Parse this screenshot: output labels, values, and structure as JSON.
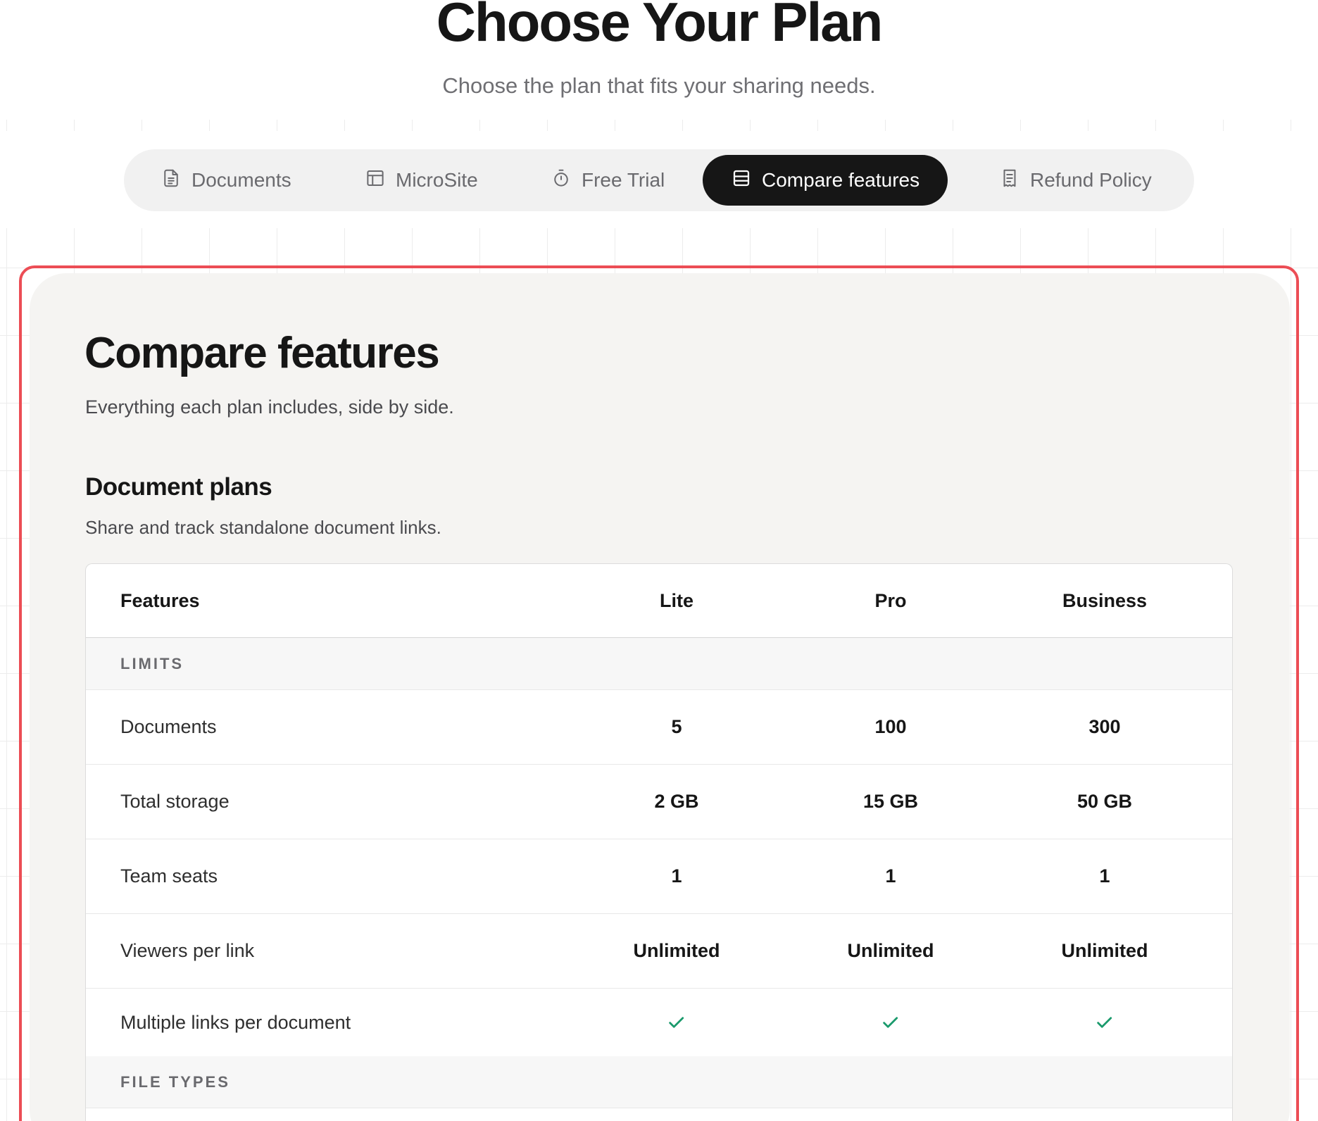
{
  "hero": {
    "title": "Choose Your Plan",
    "subtitle": "Choose the plan that fits your sharing needs."
  },
  "tabs": [
    {
      "label": "Documents",
      "icon": "document-icon",
      "active": false
    },
    {
      "label": "MicroSite",
      "icon": "layout-icon",
      "active": false
    },
    {
      "label": "Free Trial",
      "icon": "stopwatch-icon",
      "active": false
    },
    {
      "label": "Compare features",
      "icon": "table-icon",
      "active": true
    },
    {
      "label": "Refund Policy",
      "icon": "receipt-icon",
      "active": false
    }
  ],
  "compare": {
    "title": "Compare features",
    "subtitle": "Everything each plan includes, side by side.",
    "section": {
      "title": "Document plans",
      "subtitle": "Share and track standalone document links."
    },
    "table": {
      "headers": [
        "Features",
        "Lite",
        "Pro",
        "Business"
      ],
      "groups": [
        {
          "label": "LIMITS",
          "rows": [
            {
              "feature": "Documents",
              "values": [
                "5",
                "100",
                "300"
              ]
            },
            {
              "feature": "Total storage",
              "values": [
                "2 GB",
                "15 GB",
                "50 GB"
              ]
            },
            {
              "feature": "Team seats",
              "values": [
                "1",
                "1",
                "1"
              ]
            },
            {
              "feature": "Viewers per link",
              "values": [
                "Unlimited",
                "Unlimited",
                "Unlimited"
              ]
            },
            {
              "feature": "Multiple links per document",
              "values": [
                "check-icon",
                "check-icon",
                "check-icon"
              ]
            }
          ]
        },
        {
          "label": "FILE TYPES",
          "rows": []
        }
      ]
    }
  },
  "colors": {
    "accent_frame": "#ec4d55",
    "check": "#1a9a6c",
    "active_tab": "#161616"
  }
}
